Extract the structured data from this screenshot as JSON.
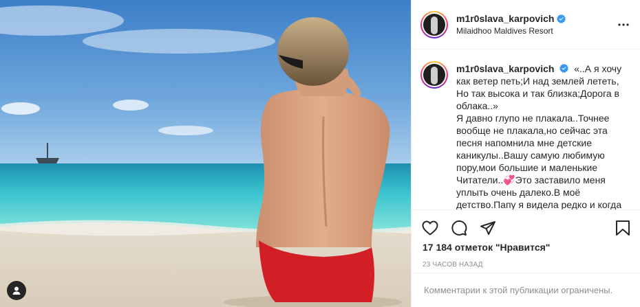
{
  "post": {
    "username": "m1r0slava_karpovich",
    "location": "Milaidhoo Maldives Resort",
    "caption": "«..А я хочу как ветер петь;И над землей лететь, Но так высока и так близка;Дорога в облака..»\nЯ давно глупо не плакала..Точнее вообще не плакала,но сейчас эта песня напомнила мне детские каникулы..Вашу самую любимую пору,мои большие и маленькие Читатели..💞Это заставило меня уплыть очень далеко.В моё детство.Папу я видела редко и когда",
    "likes_text": "17 184 отметок \"Нравится\"",
    "time_text": "23 ЧАСОВ НАЗАД",
    "comments_closed_text": "Комментарии к этой публикации ограничены."
  },
  "icons": {
    "verified": "verified-badge-icon",
    "more": "more-options-icon",
    "like": "heart-icon",
    "comment": "comment-icon",
    "share": "share-icon",
    "save": "bookmark-icon",
    "tag": "user-tag-icon"
  },
  "colors": {
    "verified": "#3897f0",
    "muted": "#8e8e8e",
    "text": "#262626",
    "border": "#efefef"
  }
}
